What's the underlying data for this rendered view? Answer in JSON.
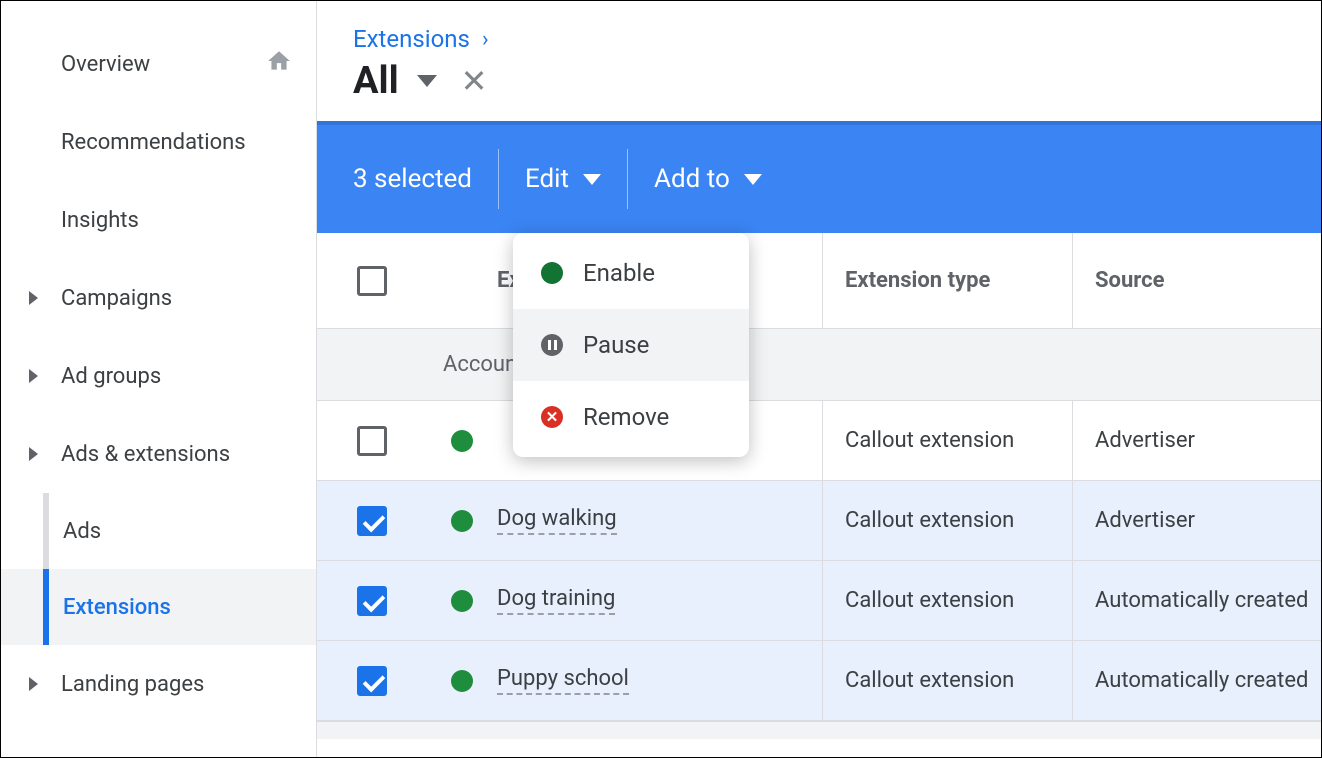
{
  "sidebar": {
    "items": [
      {
        "label": "Overview",
        "home": true
      },
      {
        "label": "Recommendations"
      },
      {
        "label": "Insights"
      },
      {
        "label": "Campaigns",
        "expandable": true
      },
      {
        "label": "Ad groups",
        "expandable": true
      },
      {
        "label": "Ads & extensions",
        "expandable": true
      }
    ],
    "sub": {
      "ads": "Ads",
      "extensions": "Extensions"
    },
    "landing": "Landing pages"
  },
  "header": {
    "breadcrumb": "Extensions",
    "title": "All"
  },
  "toolbar": {
    "selected": "3 selected",
    "edit": "Edit",
    "addto": "Add to"
  },
  "menu": {
    "enable": "Enable",
    "pause": "Pause",
    "remove": "Remove"
  },
  "table": {
    "headers": {
      "extension": "Extension",
      "type": "Extension type",
      "source": "Source"
    },
    "group": "Account",
    "rows": [
      {
        "selected": false,
        "name": "",
        "type": "Callout extension",
        "source": "Advertiser"
      },
      {
        "selected": true,
        "name": "Dog walking",
        "type": "Callout extension",
        "source": "Advertiser"
      },
      {
        "selected": true,
        "name": "Dog training",
        "type": "Callout extension",
        "source": "Automatically created"
      },
      {
        "selected": true,
        "name": "Puppy school",
        "type": "Callout extension",
        "source": "Automatically created"
      }
    ]
  }
}
